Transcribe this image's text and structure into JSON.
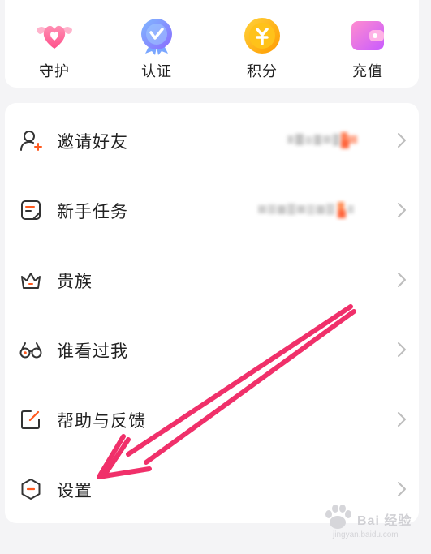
{
  "quick_actions": [
    {
      "label": "守护",
      "icon": "heart-wings-icon"
    },
    {
      "label": "认证",
      "icon": "verified-badge-icon"
    },
    {
      "label": "积分",
      "icon": "points-coin-icon"
    },
    {
      "label": "充值",
      "icon": "wallet-icon"
    }
  ],
  "menu": [
    {
      "label": "邀请好友",
      "icon": "invite-user-icon"
    },
    {
      "label": "新手任务",
      "icon": "task-note-icon"
    },
    {
      "label": "贵族",
      "icon": "crown-icon"
    },
    {
      "label": "谁看过我",
      "icon": "glasses-icon"
    },
    {
      "label": "帮助与反馈",
      "icon": "feedback-edit-icon"
    },
    {
      "label": "设置",
      "icon": "settings-hex-icon"
    }
  ],
  "watermark": {
    "brand": "Bai 经验",
    "sub": "jingyan.baidu.com"
  },
  "colors": {
    "accent": "#ff5a1f",
    "arrow": "#f0306a",
    "text": "#222222",
    "chevron": "#bdbdbd"
  }
}
